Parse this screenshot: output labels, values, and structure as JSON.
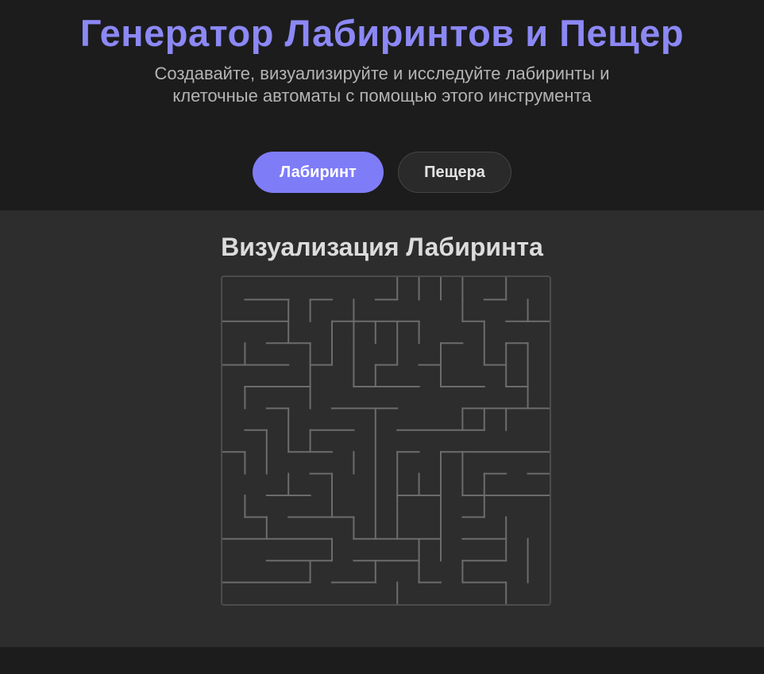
{
  "header": {
    "title": "Генератор Лабиринтов и Пещер",
    "subtitle": "Создавайте, визуализируйте и исследуйте лабиринты и клеточные автоматы с помощью этого инструмента"
  },
  "tabs": [
    {
      "label": "Лабиринт",
      "active": true
    },
    {
      "label": "Пещера",
      "active": false
    }
  ],
  "panel": {
    "title": "Визуализация Лабиринта"
  },
  "maze": {
    "rows": 15,
    "cols": 15,
    "colors": {
      "walls": "#6c6c6c",
      "border": "#4c4c4c"
    }
  },
  "colors": {
    "accent": "#7f7cf8",
    "title": "#8c88f5",
    "background": "#1c1c1c",
    "panel": "#2d2d2d"
  }
}
